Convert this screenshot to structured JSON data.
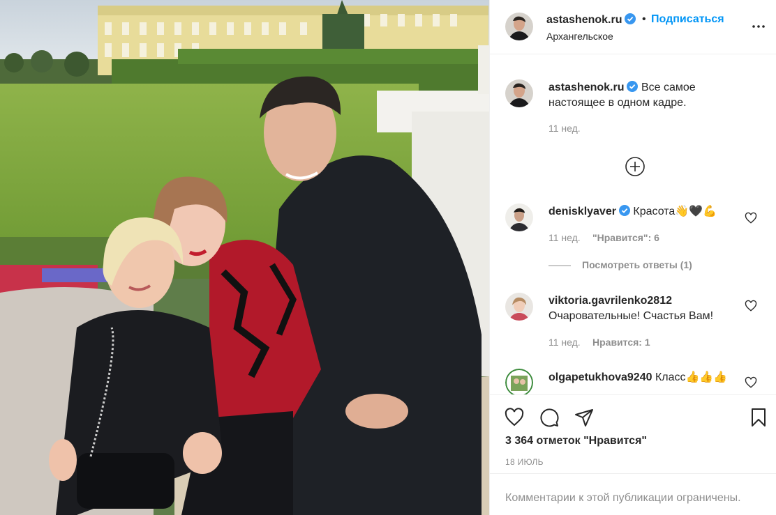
{
  "post": {
    "author": "astashenok.ru",
    "separator": "•",
    "follow_label": "Подписаться",
    "location": "Архангельское",
    "more_icon": "more-horizontal-icon"
  },
  "caption": {
    "author": "astashenok.ru",
    "text_line1": "Все самое",
    "text_line2": "настоящее в одном кадре.",
    "time": "11 нед."
  },
  "comments": [
    {
      "author": "denisklyaver",
      "verified": true,
      "text": "Красота👋🖤💪",
      "time": "11 нед.",
      "likes_label": "\"Нравится\": 6",
      "view_replies": "Посмотреть ответы (1)"
    },
    {
      "author": "viktoria.gavrilenko2812",
      "verified": false,
      "text": "Очаровательные! Счастья Вам!",
      "time": "11 нед.",
      "likes_label": "Нравится: 1"
    },
    {
      "author": "olgapetukhova9240",
      "verified": false,
      "text": "Класс👍👍👍"
    }
  ],
  "actions": {
    "like_icon": "heart-icon",
    "comment_icon": "comment-icon",
    "share_icon": "share-icon",
    "save_icon": "bookmark-icon"
  },
  "likes_count": "3 364 отметок \"Нравится\"",
  "date": "18 ИЮЛЬ",
  "footer_notice": "Комментарии к этой публикации ограничены.",
  "colors": {
    "link_blue": "#0095f6",
    "text": "#262626",
    "muted": "#8e8e8e",
    "border": "#efefef",
    "verified": "#3897f0"
  }
}
